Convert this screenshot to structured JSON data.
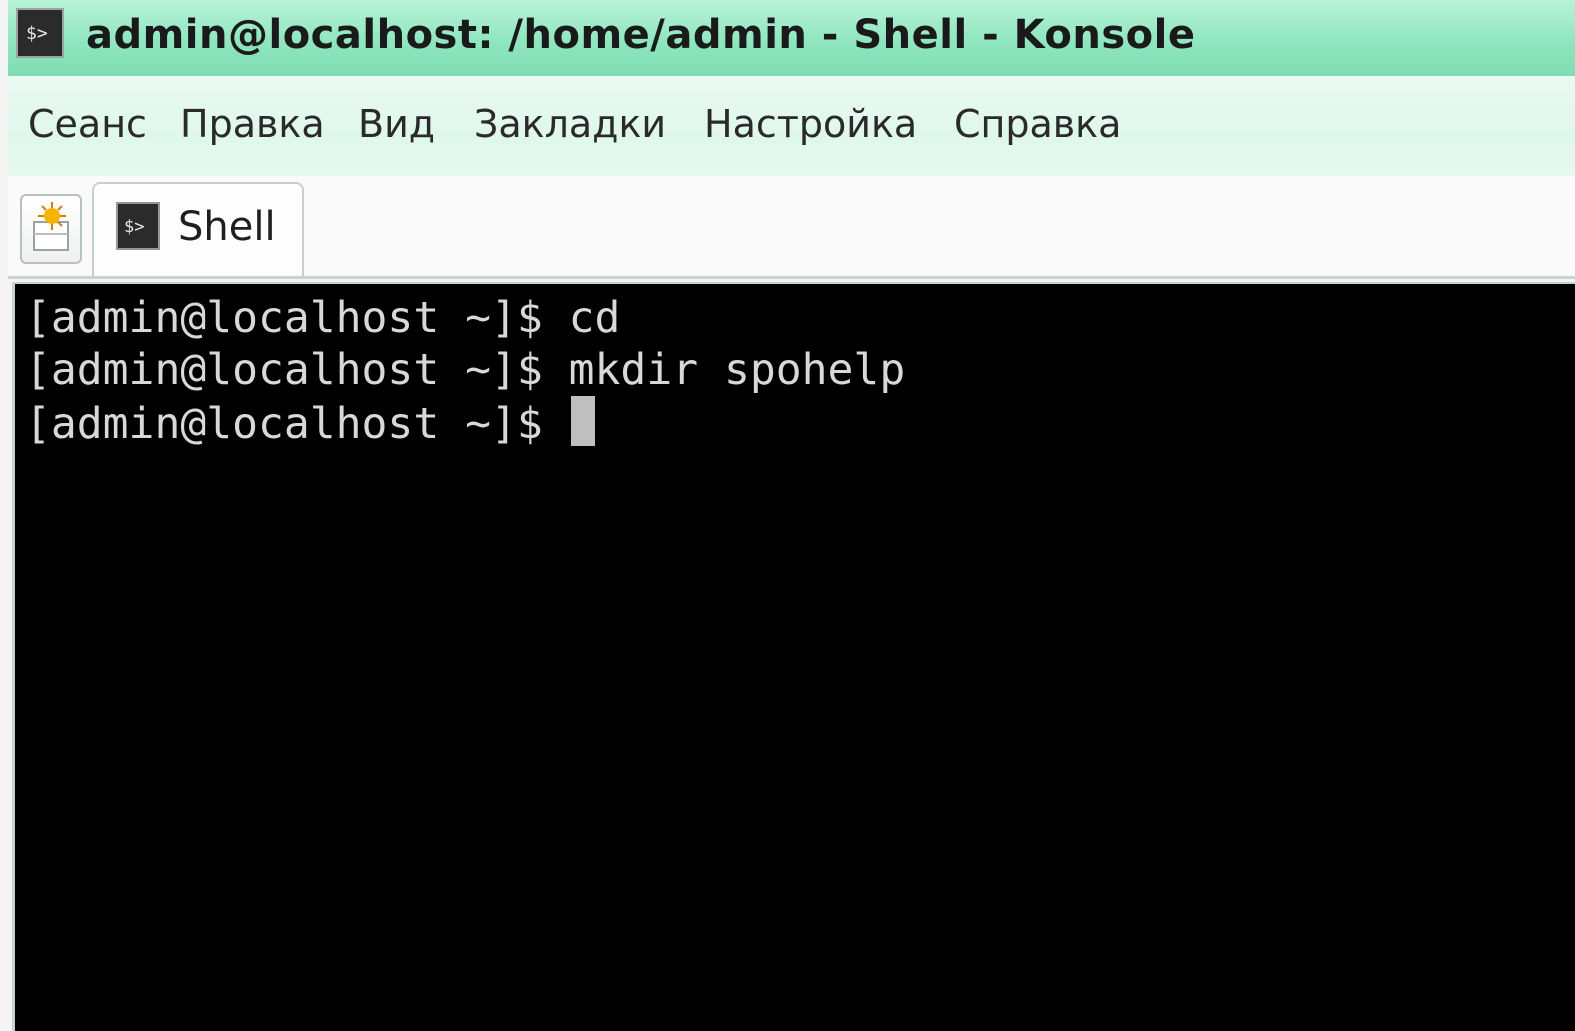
{
  "window": {
    "title": "admin@localhost: /home/admin - Shell - Konsole"
  },
  "menu": {
    "items": [
      "Сеанс",
      "Правка",
      "Вид",
      "Закладки",
      "Настройка",
      "Справка"
    ]
  },
  "tabs": [
    {
      "label": "Shell",
      "active": true
    }
  ],
  "terminal": {
    "lines": [
      {
        "prompt": "[admin@localhost ~]$ ",
        "command": "cd"
      },
      {
        "prompt": "[admin@localhost ~]$ ",
        "command": "mkdir spohelp"
      },
      {
        "prompt": "[admin@localhost ~]$ ",
        "command": ""
      }
    ],
    "colors": {
      "background": "#000000",
      "foreground": "#d8d8d8",
      "cursor": "#bfbfbf"
    }
  },
  "icons": {
    "title": "terminal-app-icon",
    "new_tab": "new-tab-icon",
    "tab": "terminal-tab-icon"
  }
}
